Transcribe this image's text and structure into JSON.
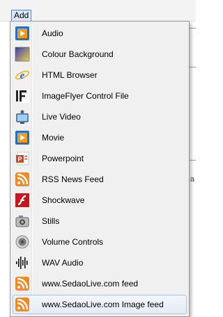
{
  "menubar": {
    "add_label": "Add"
  },
  "background": {
    "fragment_label": "a"
  },
  "menu": {
    "items": [
      {
        "label": "Audio",
        "icon": "audio-icon"
      },
      {
        "label": "Colour Background",
        "icon": "colour-background-icon"
      },
      {
        "label": "HTML Browser",
        "icon": "html-browser-icon"
      },
      {
        "label": "ImageFlyer Control File",
        "icon": "imageflyer-control-file-icon"
      },
      {
        "label": "Live Video",
        "icon": "live-video-icon"
      },
      {
        "label": "Movie",
        "icon": "movie-icon"
      },
      {
        "label": "Powerpoint",
        "icon": "powerpoint-icon"
      },
      {
        "label": "RSS News Feed",
        "icon": "rss-icon"
      },
      {
        "label": "Shockwave",
        "icon": "shockwave-icon"
      },
      {
        "label": "Stills",
        "icon": "stills-icon"
      },
      {
        "label": "Volume Controls",
        "icon": "volume-controls-icon"
      },
      {
        "label": "WAV Audio",
        "icon": "wav-audio-icon"
      },
      {
        "label": "www.SedaoLive.com feed",
        "icon": "sedaolive-feed-icon"
      },
      {
        "label": "www.SedaoLive.com Image feed",
        "icon": "sedaolive-image-feed-icon"
      }
    ],
    "highlighted_item": "www.SedaoLive.com Image feed"
  },
  "colors": {
    "menu_bg": "#f0f0f0",
    "hover_border": "#a8c4e6",
    "menubar_highlight": "#dde8f6"
  }
}
